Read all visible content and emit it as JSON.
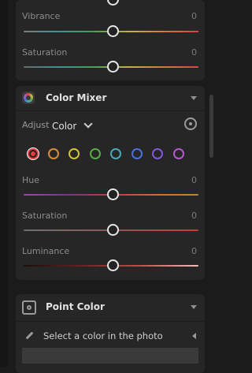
{
  "top_sliders": [
    {
      "label": "Vibrance",
      "value": "0"
    },
    {
      "label": "Saturation",
      "value": "0"
    }
  ],
  "color_mixer": {
    "title": "Color Mixer",
    "adjust_label": "Adjust",
    "adjust_value": "Color",
    "swatches": [
      {
        "name": "red",
        "color": "#e04040",
        "selected": true
      },
      {
        "name": "orange",
        "color": "#d98a3a"
      },
      {
        "name": "yellow",
        "color": "#d1c43c"
      },
      {
        "name": "green",
        "color": "#5aaa46"
      },
      {
        "name": "aqua",
        "color": "#4aa9b3"
      },
      {
        "name": "blue",
        "color": "#4b6fdc"
      },
      {
        "name": "purple",
        "color": "#7f5ad6"
      },
      {
        "name": "magenta",
        "color": "#b25ac9"
      }
    ],
    "sliders": [
      {
        "label": "Hue",
        "value": "0"
      },
      {
        "label": "Saturation",
        "value": "0"
      },
      {
        "label": "Luminance",
        "value": "0"
      }
    ]
  },
  "point_color": {
    "title": "Point Color",
    "picker_text": "Select a color in the photo"
  }
}
